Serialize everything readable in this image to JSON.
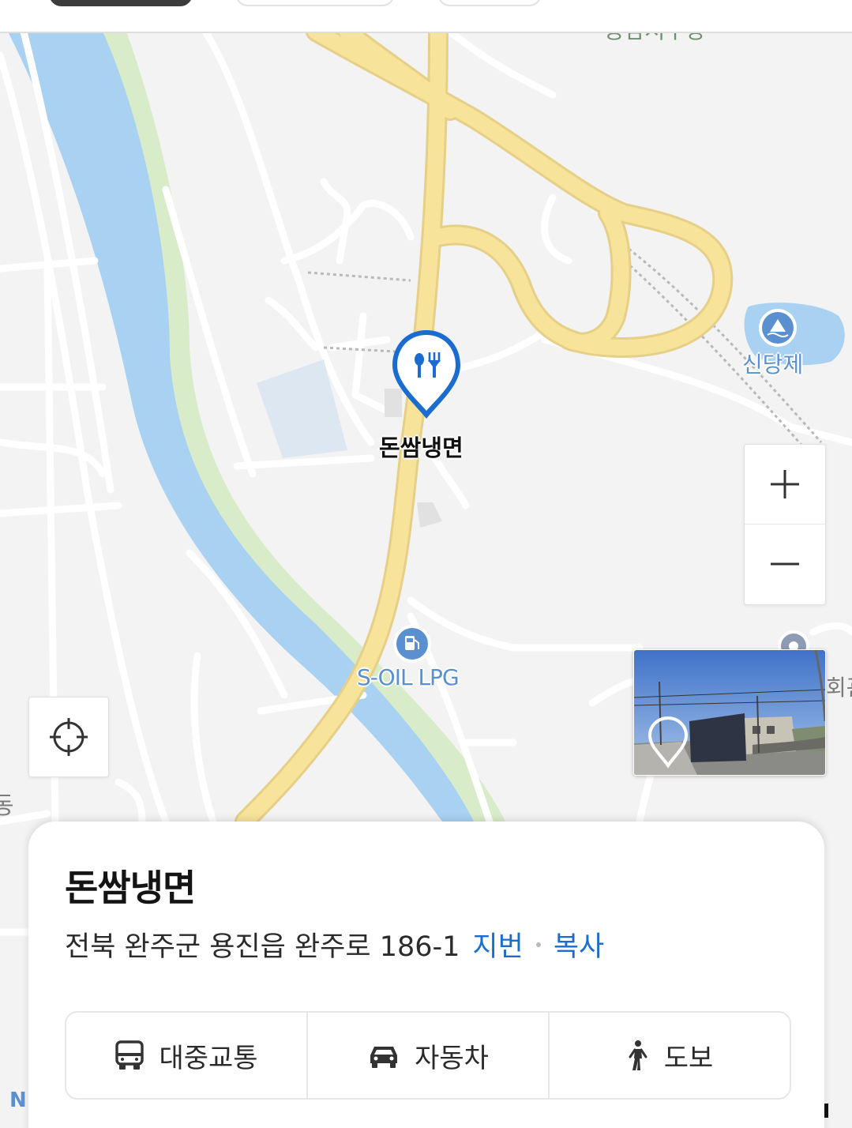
{
  "map": {
    "marker_label": "돈쌈냉면",
    "marker_icon": "restaurant-fork-knife-icon",
    "pois": [
      {
        "name": "신당제",
        "icon": "water-reservoir-icon"
      },
      {
        "name": "S-OIL LPG",
        "icon": "gas-station-icon"
      }
    ],
    "colors": {
      "river": "#a8d1f2",
      "riverbank": "#d9ecc9",
      "highway": "#f8e39a",
      "marker": "#1a6cd0"
    }
  },
  "controls": {
    "zoom_in_icon": "plus-icon",
    "zoom_out_icon": "minus-icon",
    "locate_icon": "crosshair-icon",
    "roadview_icon": "location-pin-icon"
  },
  "place": {
    "name": "돈쌈냉면",
    "address": "전북 완주군 용진읍 완주로 186-1",
    "lot_number_link": "지번",
    "copy_link": "복사"
  },
  "routes": [
    {
      "label": "대중교통",
      "icon": "bus-icon"
    },
    {
      "label": "자동차",
      "icon": "car-icon"
    },
    {
      "label": "도보",
      "icon": "walking-person-icon"
    }
  ],
  "corner_label": "N"
}
